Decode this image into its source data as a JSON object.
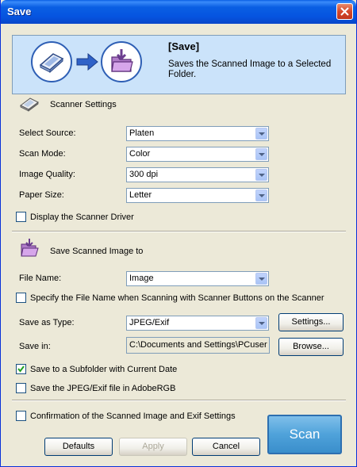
{
  "window": {
    "title": "Save"
  },
  "banner": {
    "title": "[Save]",
    "description": "Saves the Scanned Image to a Selected Folder."
  },
  "scanner_settings": {
    "heading": "Scanner Settings",
    "select_source": {
      "label": "Select Source:",
      "value": "Platen"
    },
    "scan_mode": {
      "label": "Scan Mode:",
      "value": "Color"
    },
    "image_quality": {
      "label": "Image Quality:",
      "value": "300 dpi"
    },
    "paper_size": {
      "label": "Paper Size:",
      "value": "Letter"
    },
    "display_driver": {
      "label": "Display the Scanner Driver",
      "checked": false
    }
  },
  "save_settings": {
    "heading": "Save Scanned Image to",
    "file_name": {
      "label": "File Name:",
      "value": "Image"
    },
    "specify_name": {
      "label": "Specify the File Name when Scanning with Scanner Buttons on the Scanner",
      "checked": false
    },
    "save_type": {
      "label": "Save as Type:",
      "value": "JPEG/Exif"
    },
    "settings_button": "Settings...",
    "save_in": {
      "label": "Save in:",
      "value": "C:\\Documents and Settings\\PCuser"
    },
    "browse_button": "Browse...",
    "subfolder": {
      "label": "Save to a Subfolder with Current Date",
      "checked": true
    },
    "adobe_rgb": {
      "label": "Save the JPEG/Exif file in AdobeRGB",
      "checked": false
    }
  },
  "footer": {
    "confirmation": {
      "label": "Confirmation of the Scanned Image and Exif Settings",
      "checked": false
    },
    "defaults_button": "Defaults",
    "apply_button": "Apply",
    "cancel_button": "Cancel",
    "scan_button": "Scan"
  }
}
